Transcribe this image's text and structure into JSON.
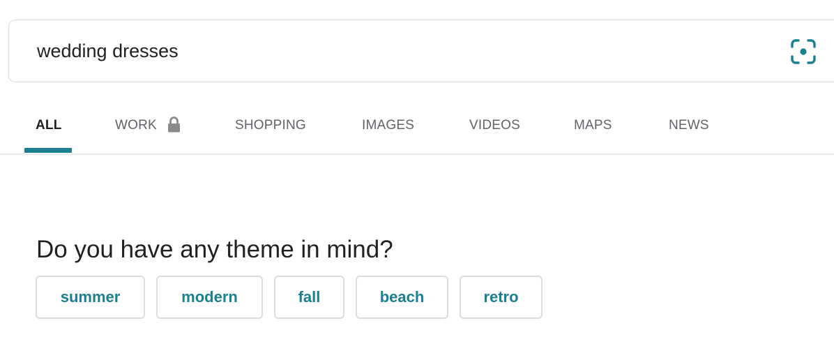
{
  "search": {
    "query": "wedding dresses",
    "visual_search_icon": "visual-search-icon"
  },
  "tabs": [
    {
      "label": "ALL",
      "active": true
    },
    {
      "label": "WORK",
      "icon": "lock-icon"
    },
    {
      "label": "SHOPPING"
    },
    {
      "label": "IMAGES"
    },
    {
      "label": "VIDEOS"
    },
    {
      "label": "MAPS"
    },
    {
      "label": "NEWS"
    }
  ],
  "theme_prompt": {
    "question": "Do you have any theme in mind?",
    "options": [
      "summer",
      "modern",
      "fall",
      "beach",
      "retro"
    ]
  },
  "colors": {
    "accent": "#1a7f8e",
    "text": "#202124",
    "muted": "#5f6368",
    "border": "#dadce0"
  }
}
